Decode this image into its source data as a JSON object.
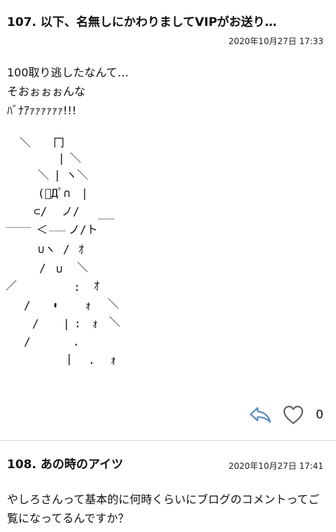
{
  "comments": [
    {
      "number_title": "107.  以下、名無しにかわりましてVIPがお送り…",
      "date": "2020年10月27日 17:33",
      "body_lines": [
        "100取り逃したなんて…",
        "そおぉぉぉんな",
        "ﾊﾞﾅｱｧｧｧｧｧｧ!!!"
      ],
      "aa": [
        "＼",
        "冂",
        "|",
        "＼",
        "＼",
        "|",
        "ヽ",
        "＼",
        "(ﾟДﾟ∩",
        "|",
        "⊂/",
        "ノ/",
        "＿＿＿",
        "＜",
        "＿＿",
        "ノ/ト",
        "￣￣",
        "∪ヽ",
        "/",
        "ｵ",
        "/",
        "∪",
        "＼",
        "／",
        ":",
        "ｵ",
        "/",
        "▮",
        "ｫ",
        "＼",
        "/",
        "|",
        ":",
        "ｫ",
        "＼",
        "/",
        ".",
        "|",
        ".",
        "ｫ"
      ],
      "likes": "0",
      "reply_icon": "reply-arrow-icon",
      "like_icon": "heart-outline-icon"
    },
    {
      "number_title": "108.  あの時のアイツ",
      "date": "2020年10月27日 17:41",
      "body": "やしろさんって基本的に何時くらいにブログのコメントってご覧になってるんですか？"
    }
  ],
  "colors": {
    "reply_icon": "#5b8fc4",
    "heart_icon": "#666666",
    "divider": "#d9d9d9"
  }
}
